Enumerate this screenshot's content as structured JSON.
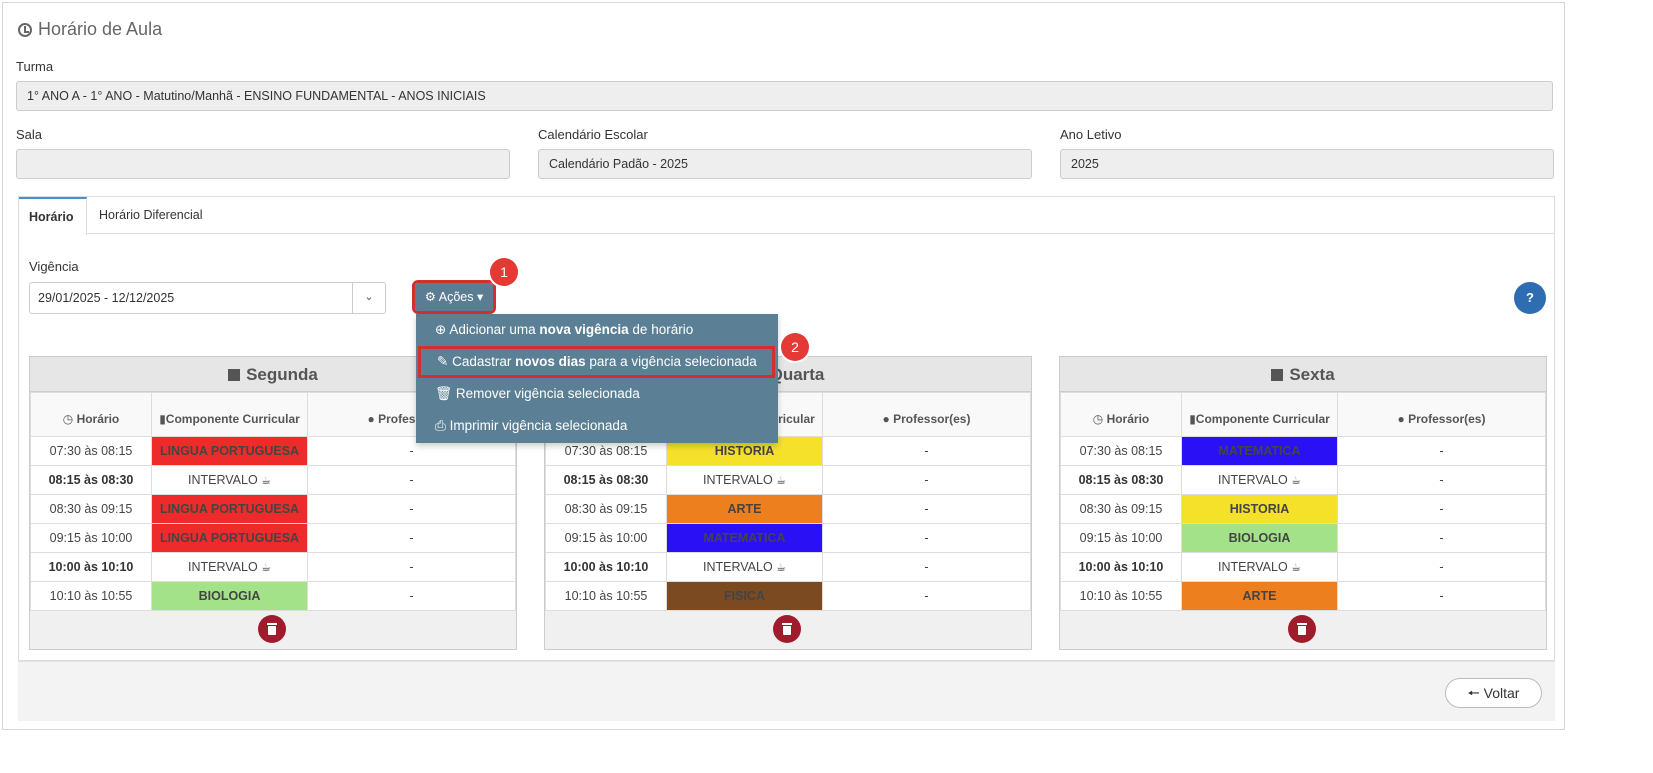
{
  "page": {
    "title": "Horário de Aula"
  },
  "turma": {
    "label": "Turma",
    "value": "1° ANO A - 1° ANO - Matutino/Manhã - ENSINO FUNDAMENTAL - ANOS INICIAIS"
  },
  "sala": {
    "label": "Sala",
    "value": ""
  },
  "calendario": {
    "label": "Calendário Escolar",
    "value": "Calendário Padão - 2025"
  },
  "ano": {
    "label": "Ano Letivo",
    "value": "2025"
  },
  "tabs": [
    {
      "label": "Horário"
    },
    {
      "label": "Horário Diferencial"
    }
  ],
  "vigencia": {
    "label": "Vigência",
    "value": "29/01/2025 - 12/12/2025"
  },
  "acoes": {
    "label": "Ações ▾",
    "items": [
      {
        "pre": "Adicionar uma ",
        "bold": "nova vigência",
        "post": " de horário"
      },
      {
        "pre": "Cadastrar ",
        "bold": "novos dias",
        "post": " para a vigência selecionada"
      },
      {
        "pre": "Remover vigência selecionada",
        "bold": "",
        "post": ""
      },
      {
        "pre": "Imprimir vigência selecionada",
        "bold": "",
        "post": ""
      }
    ]
  },
  "badges": [
    "1",
    "2"
  ],
  "headers": {
    "horario": "Horário",
    "componente": "Componente Curricular",
    "professores": "Professor(es)",
    "componente_partial": "te",
    "professores_partial": "Profes"
  },
  "days": [
    {
      "name": "Segunda",
      "rows": [
        {
          "time": "07:30 às 08:15",
          "bold": false,
          "comp": "LINGUA PORTUGUESA",
          "color": "#ee2b2b",
          "prof": "-"
        },
        {
          "time": "08:15 às 08:30",
          "bold": true,
          "comp": "INTERVALO",
          "color": "",
          "prof": "-"
        },
        {
          "time": "08:30 às 09:15",
          "bold": false,
          "comp": "LINGUA PORTUGUESA",
          "color": "#ee2b2b",
          "prof": "-"
        },
        {
          "time": "09:15 às 10:00",
          "bold": false,
          "comp": "LINGUA PORTUGUESA",
          "color": "#ee2b2b",
          "prof": "-"
        },
        {
          "time": "10:00 às 10:10",
          "bold": true,
          "comp": "INTERVALO",
          "color": "",
          "prof": "-"
        },
        {
          "time": "10:10 às 10:55",
          "bold": false,
          "comp": "BIOLOGIA",
          "color": "#a4e28a",
          "prof": "-"
        }
      ]
    },
    {
      "name": "Quarta",
      "rows": [
        {
          "time": "07:30 às 08:15",
          "bold": false,
          "comp": "HISTORIA",
          "color": "#f5e02a",
          "prof": "-"
        },
        {
          "time": "08:15 às 08:30",
          "bold": true,
          "comp": "INTERVALO",
          "color": "",
          "prof": "-"
        },
        {
          "time": "08:30 às 09:15",
          "bold": false,
          "comp": "ARTE",
          "color": "#ee7f1e",
          "prof": "-"
        },
        {
          "time": "09:15 às 10:00",
          "bold": false,
          "comp": "MATEMATICA",
          "color": "#2a11f5",
          "prof": "-"
        },
        {
          "time": "10:00 às 10:10",
          "bold": true,
          "comp": "INTERVALO",
          "color": "",
          "prof": "-"
        },
        {
          "time": "10:10 às 10:55",
          "bold": false,
          "comp": "FISICA",
          "color": "#7b4a21",
          "prof": "-"
        }
      ]
    },
    {
      "name": "Sexta",
      "rows": [
        {
          "time": "07:30 às 08:15",
          "bold": false,
          "comp": "MATEMATICA",
          "color": "#2a11f5",
          "prof": "-"
        },
        {
          "time": "08:15 às 08:30",
          "bold": true,
          "comp": "INTERVALO",
          "color": "",
          "prof": "-"
        },
        {
          "time": "08:30 às 09:15",
          "bold": false,
          "comp": "HISTORIA",
          "color": "#f5e02a",
          "prof": "-"
        },
        {
          "time": "09:15 às 10:00",
          "bold": false,
          "comp": "BIOLOGIA",
          "color": "#a4e28a",
          "prof": "-"
        },
        {
          "time": "10:00 às 10:10",
          "bold": true,
          "comp": "INTERVALO",
          "color": "",
          "prof": "-"
        },
        {
          "time": "10:10 às 10:55",
          "bold": false,
          "comp": "ARTE",
          "color": "#ee7f1e",
          "prof": "-"
        }
      ]
    }
  ],
  "footer": {
    "voltar": "Voltar"
  }
}
